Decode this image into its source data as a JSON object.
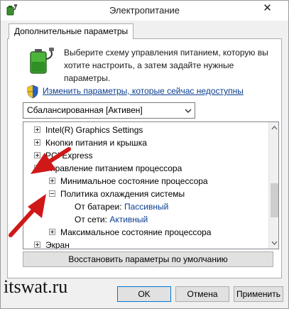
{
  "window": {
    "title": "Электропитание",
    "close_glyph": "✕"
  },
  "tab": {
    "label": "Дополнительные параметры"
  },
  "description": "Выберите схему управления питанием, которую вы хотите настроить, а затем задайте нужные параметры.",
  "change_link": "Изменить параметры, которые сейчас недоступны",
  "plan_select": {
    "value": "Сбалансированная [Активен]"
  },
  "tree": {
    "items": [
      {
        "label": "Intel(R) Graphics Settings",
        "expander": "plus"
      },
      {
        "label": "Кнопки питания и крышка",
        "expander": "plus"
      },
      {
        "label": "PCI Express",
        "expander": "plus"
      },
      {
        "label": "Управление питанием процессора",
        "expander": "minus"
      },
      {
        "label": "Минимальное состояние процессора",
        "expander": "plus"
      },
      {
        "label": "Политика охлаждения системы",
        "expander": "minus"
      },
      {
        "label": "От батареи:",
        "value": "Пассивный"
      },
      {
        "label": "От сети:",
        "value": "Активный"
      },
      {
        "label": "Максимальное состояние процессора",
        "expander": "plus"
      },
      {
        "label": "Экран",
        "expander": "plus"
      }
    ]
  },
  "restore_button": "Восстановить параметры по умолчанию",
  "buttons": {
    "ok": "OK",
    "cancel": "Отмена",
    "apply": "Применить"
  },
  "watermark": "itswat.ru",
  "colors": {
    "arrow": "#d01818",
    "link": "#0b3d8f",
    "ok_border": "#0078d7"
  },
  "icons": [
    "power-options-icon",
    "battery-icon",
    "uac-shield-icon",
    "dropdown-arrow-icon",
    "close-icon"
  ]
}
